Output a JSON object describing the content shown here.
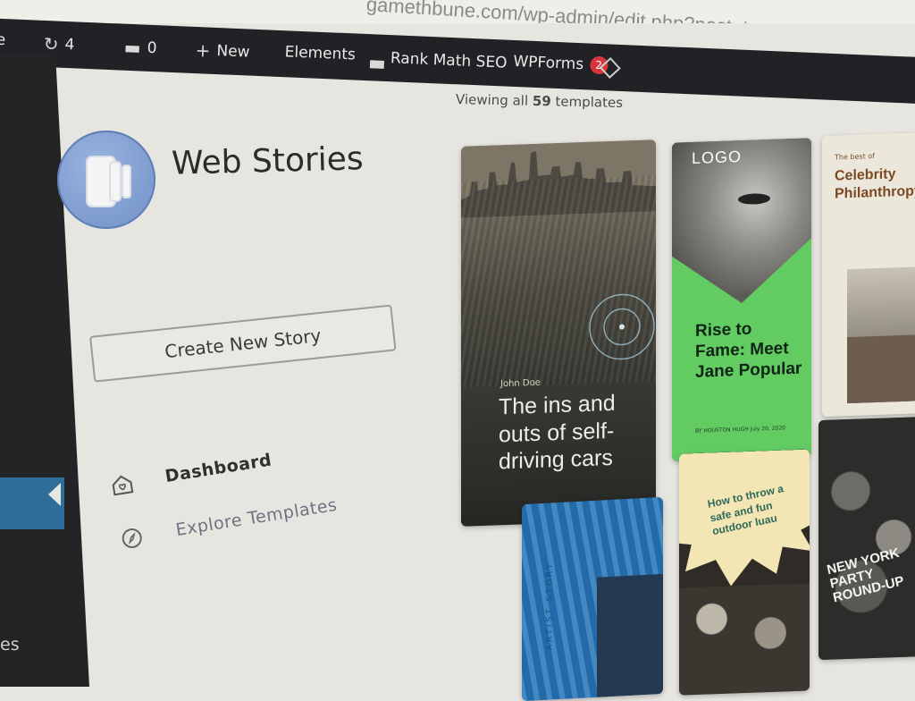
{
  "browser": {
    "url_fragment": "gamethbune.com/wp-admin/edit.php?post_type=web-story&page=stories-"
  },
  "adminbar": {
    "site_label_partial": "ne",
    "updates_icon": "refresh-icon",
    "updates_count": "4",
    "comments_icon": "comment-icon",
    "comments_count": "0",
    "new_icon": "plus-icon",
    "new_label": "New",
    "elements_label": "Elements",
    "rankmath_icon": "chart-icon",
    "rankmath_label": "Rank Math SEO",
    "wpforms_label": "WPForms",
    "wpforms_badge": "2",
    "extra_icon": "diamond-icon"
  },
  "wpmenu": {
    "partial_label_top": "",
    "partial_label_bottom": "es",
    "active_color": "#2d6f9a"
  },
  "sidebar": {
    "brand_icon": "web-stories-logo-icon",
    "brand_title": "Web Stories",
    "create_button": "Create New Story",
    "nav": [
      {
        "label": "Dashboard",
        "icon": "home-heart-icon",
        "active": true
      },
      {
        "label": "Explore Templates",
        "icon": "compass-icon",
        "active": false
      }
    ]
  },
  "templates": {
    "viewing_prefix": "Viewing all ",
    "viewing_count": "59",
    "viewing_suffix": " templates",
    "cards": [
      {
        "id": "city",
        "author": "John Doe",
        "headline": "The ins and outs of self-driving cars"
      },
      {
        "id": "fame",
        "logo": "LOGO",
        "headline": "Rise to Fame: Meet Jane Popular",
        "byline": "BY HOUSTON HUGH  July 20, 2020"
      },
      {
        "id": "celeb",
        "tag": "The best of",
        "headline": "Celebrity Philanthropy"
      },
      {
        "id": "artist",
        "side_label": "ARTIST STORY"
      },
      {
        "id": "luau",
        "headline": "How to throw a safe and fun outdoor luau"
      },
      {
        "id": "ny",
        "headline": "NEW YORK PARTY ROUND-UP"
      }
    ]
  },
  "colors": {
    "admin_bar": "#202225",
    "badge": "#d6353b",
    "fame_green": "#62cc63",
    "artist_blue": "#2a78ba",
    "celeb_text": "#7b4a24"
  }
}
